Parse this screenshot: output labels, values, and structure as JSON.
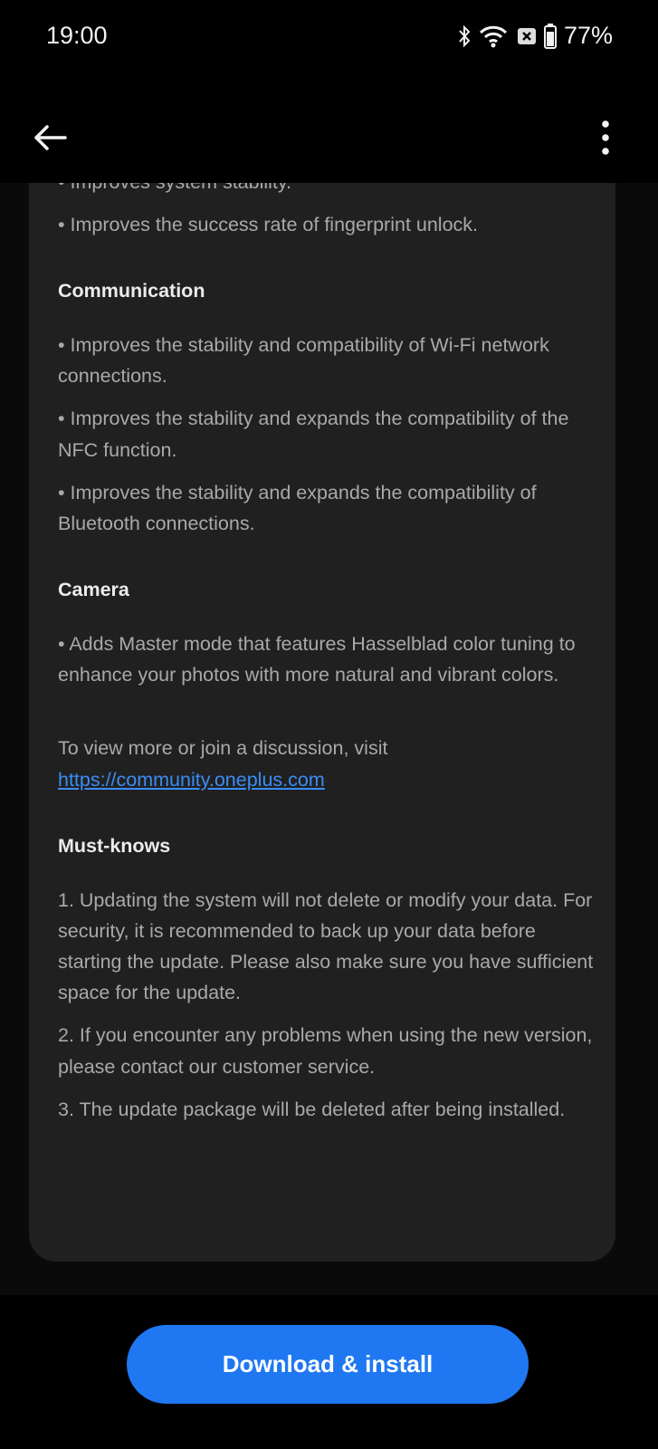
{
  "status_bar": {
    "time": "19:00",
    "battery": "77%",
    "icons": [
      "bluetooth-icon",
      "wifi-icon",
      "sim-off-icon",
      "battery-icon"
    ]
  },
  "header": {
    "back_icon": "arrow-left-icon",
    "menu_icon": "more-vertical-icon"
  },
  "content": {
    "intro_items": [
      "• Improves system stability.",
      "• Improves the success rate of fingerprint unlock."
    ],
    "sections": [
      {
        "title": "Communication",
        "items": [
          "• Improves the stability and compatibility of Wi-Fi network connections.",
          "• Improves the stability and expands the compatibility of the NFC function.",
          "• Improves the stability and expands the compatibility of Bluetooth connections."
        ]
      },
      {
        "title": "Camera",
        "items": [
          "• Adds Master mode that features Hasselblad color tuning to enhance your photos with more natural and vibrant colors."
        ]
      }
    ],
    "community_text": "To view more or join a discussion, visit",
    "community_link": "https://community.oneplus.com",
    "must_knows": {
      "title": "Must-knows",
      "items": [
        "1. Updating the system will not delete or modify your data. For security, it is recommended to back up your data before starting the update. Please also make sure you have sufficient space for the update.",
        "2. If you encounter any problems when using the new version, please contact our customer service.",
        "3. The update package will be deleted after being installed."
      ]
    }
  },
  "action": {
    "label": "Download & install",
    "color": "#1f78f2"
  }
}
